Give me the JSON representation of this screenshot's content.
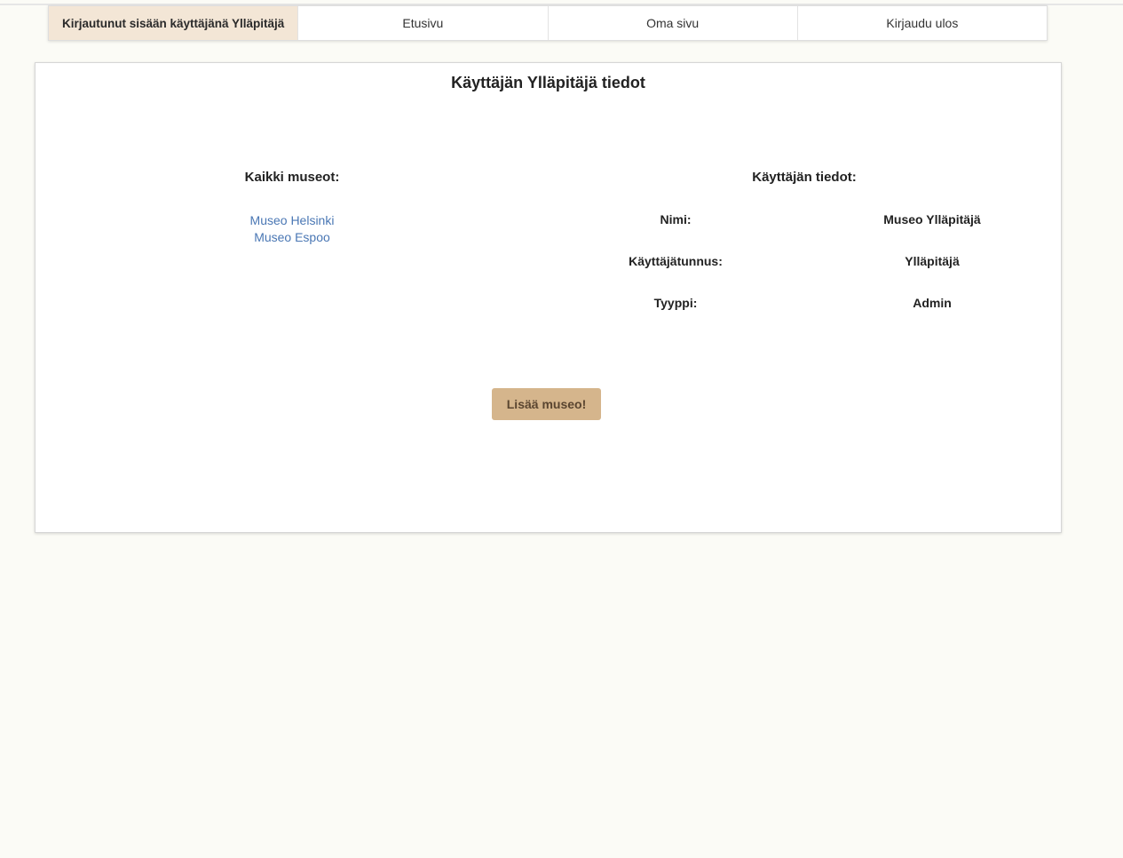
{
  "nav": {
    "logged_in": "Kirjautunut sisään käyttäjänä Ylläpitäjä",
    "home": "Etusivu",
    "own_page": "Oma sivu",
    "logout": "Kirjaudu ulos"
  },
  "main": {
    "title": "Käyttäjän Ylläpitäjä tiedot",
    "museums_heading": "Kaikki museot:",
    "museums": [
      "Museo Helsinki",
      "Museo Espoo"
    ],
    "user_heading": "Käyttäjän tiedot:",
    "user_info": [
      {
        "label": "Nimi:",
        "value": "Museo Ylläpitäjä"
      },
      {
        "label": "Käyttäjätunnus:",
        "value": "Ylläpitäjä"
      },
      {
        "label": "Tyyppi:",
        "value": "Admin"
      }
    ],
    "add_button": "Lisää museo!"
  },
  "colors": {
    "page_background": "#fbfbf6",
    "active_nav_background": "#f3e6d6",
    "link": "#4a77b4",
    "button": "#d5b58c"
  }
}
